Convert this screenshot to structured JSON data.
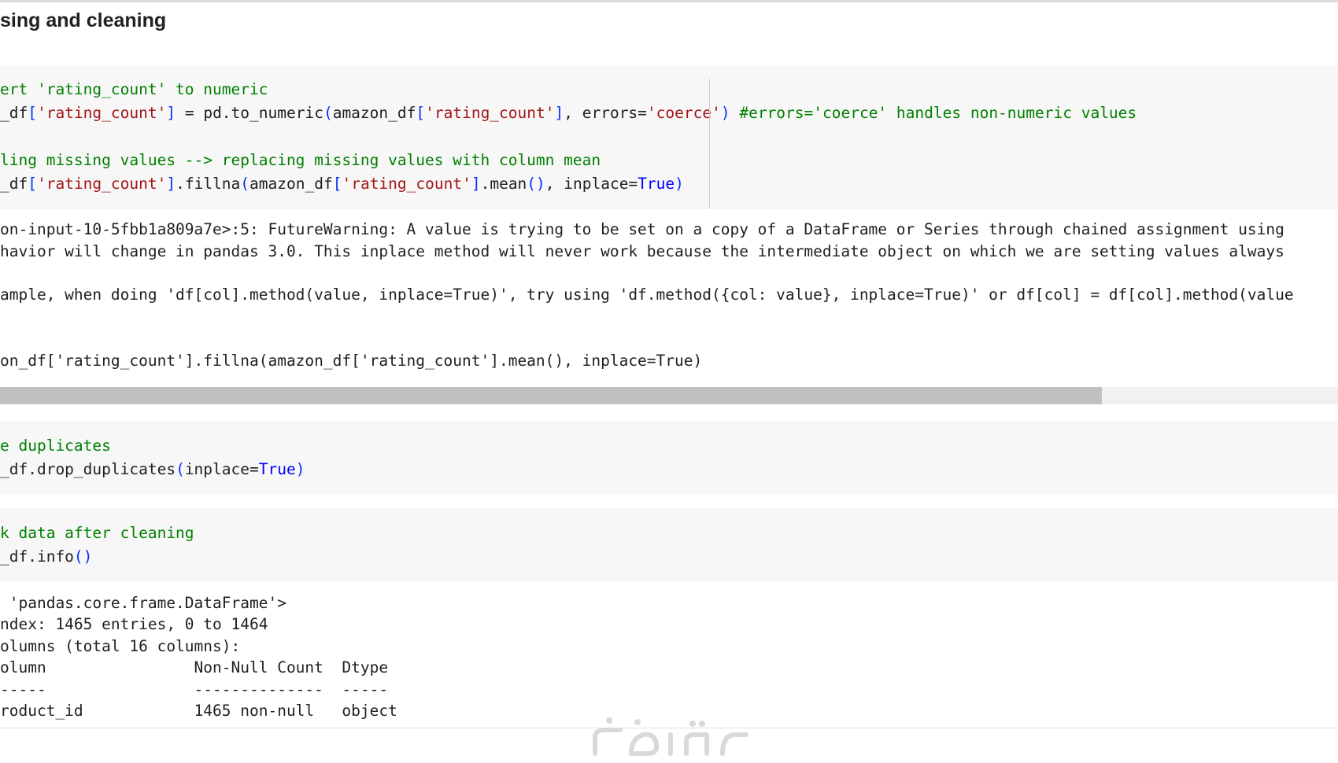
{
  "notebook": {
    "section_heading": "sing and cleaning",
    "cells": [
      {
        "lines": [
          [
            {
              "t": "ert 'rating_count' to numeric",
              "c": "c"
            }
          ],
          [
            {
              "t": "_df",
              "c": ""
            },
            {
              "t": "[",
              "c": "p"
            },
            {
              "t": "'rating_count'",
              "c": "s"
            },
            {
              "t": "]",
              "c": "p"
            },
            {
              "t": " = pd.to_numeric",
              "c": ""
            },
            {
              "t": "(",
              "c": "p"
            },
            {
              "t": "amazon_df",
              "c": ""
            },
            {
              "t": "[",
              "c": "p"
            },
            {
              "t": "'rating_count'",
              "c": "s"
            },
            {
              "t": "]",
              "c": "p"
            },
            {
              "t": ", errors=",
              "c": ""
            },
            {
              "t": "'coerce'",
              "c": "s"
            },
            {
              "t": ")",
              "c": "p"
            },
            {
              "t": " #errors='coerce' handles non-numeric values",
              "c": "c"
            }
          ],
          [
            {
              "t": "",
              "c": ""
            }
          ],
          [
            {
              "t": "ling missing values --> replacing missing values with column mean",
              "c": "c"
            }
          ],
          [
            {
              "t": "_df",
              "c": ""
            },
            {
              "t": "[",
              "c": "p"
            },
            {
              "t": "'rating_count'",
              "c": "s"
            },
            {
              "t": "]",
              "c": "p"
            },
            {
              "t": ".fillna",
              "c": ""
            },
            {
              "t": "(",
              "c": "p"
            },
            {
              "t": "amazon_df",
              "c": ""
            },
            {
              "t": "[",
              "c": "p"
            },
            {
              "t": "'rating_count'",
              "c": "s"
            },
            {
              "t": "]",
              "c": "p"
            },
            {
              "t": ".mean",
              "c": ""
            },
            {
              "t": "()",
              "c": "p"
            },
            {
              "t": ", inplace=",
              "c": ""
            },
            {
              "t": "True",
              "c": "k"
            },
            {
              "t": ")",
              "c": "p"
            }
          ]
        ],
        "output": [
          "on-input-10-5fbb1a809a7e>:5: FutureWarning: A value is trying to be set on a copy of a DataFrame or Series through chained assignment using",
          "havior will change in pandas 3.0. This inplace method will never work because the intermediate object on which we are setting values always",
          "",
          "ample, when doing 'df[col].method(value, inplace=True)', try using 'df.method({col: value}, inplace=True)' or df[col] = df[col].method(value",
          "",
          "",
          "on_df['rating_count'].fillna(amazon_df['rating_count'].mean(), inplace=True)"
        ]
      },
      {
        "lines": [
          [
            {
              "t": "e duplicates",
              "c": "c"
            }
          ],
          [
            {
              "t": "_df.drop_duplicates",
              "c": ""
            },
            {
              "t": "(",
              "c": "p"
            },
            {
              "t": "inplace=",
              "c": ""
            },
            {
              "t": "True",
              "c": "k"
            },
            {
              "t": ")",
              "c": "p"
            }
          ]
        ]
      },
      {
        "lines": [
          [
            {
              "t": "k data after cleaning",
              "c": "c"
            }
          ],
          [
            {
              "t": "_df.info",
              "c": ""
            },
            {
              "t": "()",
              "c": "p"
            }
          ]
        ],
        "output": [
          " 'pandas.core.frame.DataFrame'>",
          "ndex: 1465 entries, 0 to 1464",
          "olumns (total 16 columns):",
          "olumn                Non-Null Count  Dtype",
          "-----                --------------  -----",
          "roduct_id            1465 non-null   object"
        ]
      }
    ],
    "watermark_text": "خمسات"
  },
  "colors": {
    "cell_background": "#f7f7f7",
    "comment": "#008000",
    "string": "#a31515",
    "keyword": "#0000ff",
    "scrollbar_thumb": "#c1c1c1"
  }
}
